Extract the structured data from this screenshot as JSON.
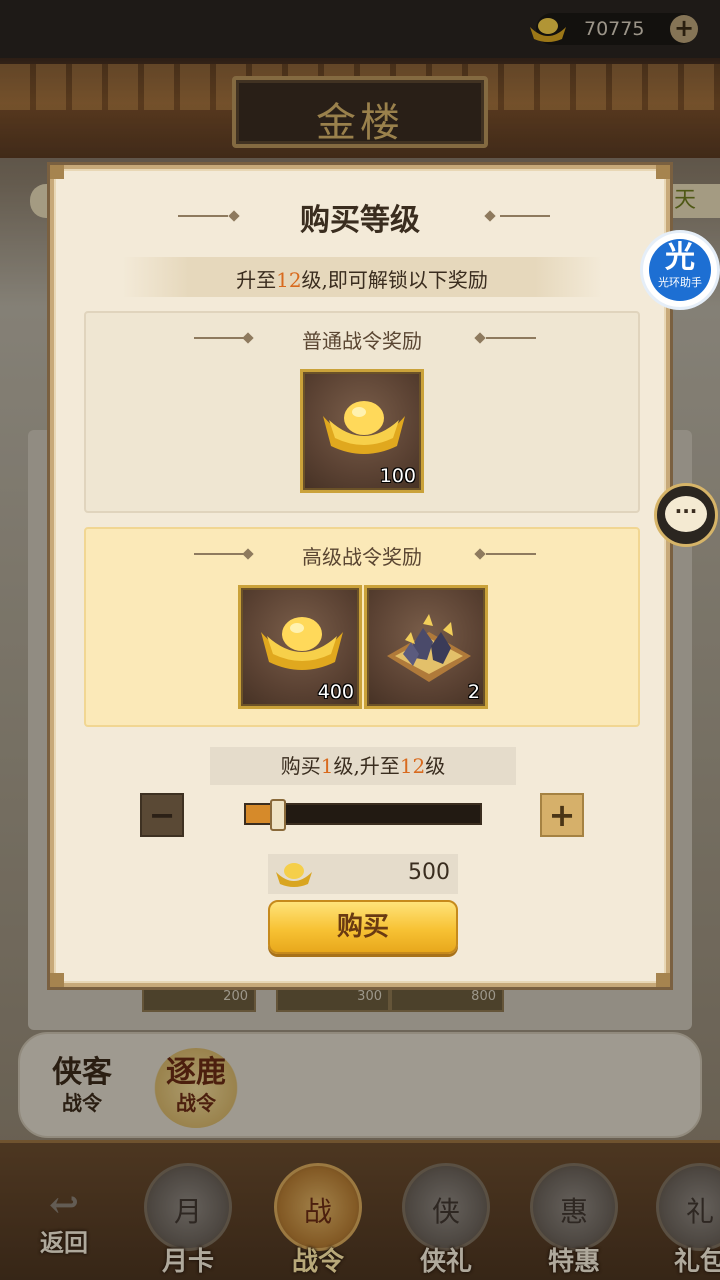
{
  "header": {
    "currency_amount": "70775",
    "building_title": "金楼",
    "side_tag": "天"
  },
  "modal": {
    "title": "购买等级",
    "unlock_text": {
      "prefix": "升至",
      "level": "12",
      "suffix": "级,即可解锁以下奖励"
    },
    "normal_rewards": {
      "title": "普通战令奖励",
      "items": [
        {
          "icon": "gold-ingot-icon",
          "count": "100"
        }
      ]
    },
    "premium_rewards": {
      "title": "高级战令奖励",
      "items": [
        {
          "icon": "gold-ingot-icon",
          "count": "400"
        },
        {
          "icon": "ore-crate-icon",
          "count": "2"
        }
      ]
    },
    "level_select": {
      "prefix": "购买",
      "buy_levels": "1",
      "mid": "级,升至",
      "target_level": "12",
      "suffix": "级",
      "slider_fraction": 0.11
    },
    "price": "500",
    "buy_label": "购买"
  },
  "background_cards": [
    "200",
    "300",
    "800"
  ],
  "pass_buttons": [
    {
      "line1": "侠客",
      "line2": "战令"
    },
    {
      "line1": "逐鹿",
      "line2": "战令"
    }
  ],
  "nav": {
    "back_label": "返回",
    "tabs": [
      {
        "label": "月卡",
        "glyph": "月"
      },
      {
        "label": "战令",
        "glyph": "战"
      },
      {
        "label": "侠礼",
        "glyph": "侠"
      },
      {
        "label": "特惠",
        "glyph": "惠"
      },
      {
        "label": "礼包",
        "glyph": "礼"
      }
    ]
  },
  "helper": {
    "glyph": "光",
    "label": "光环助手"
  },
  "colors": {
    "accent_orange": "#d86a1e",
    "gold_button": "#f7c234"
  }
}
